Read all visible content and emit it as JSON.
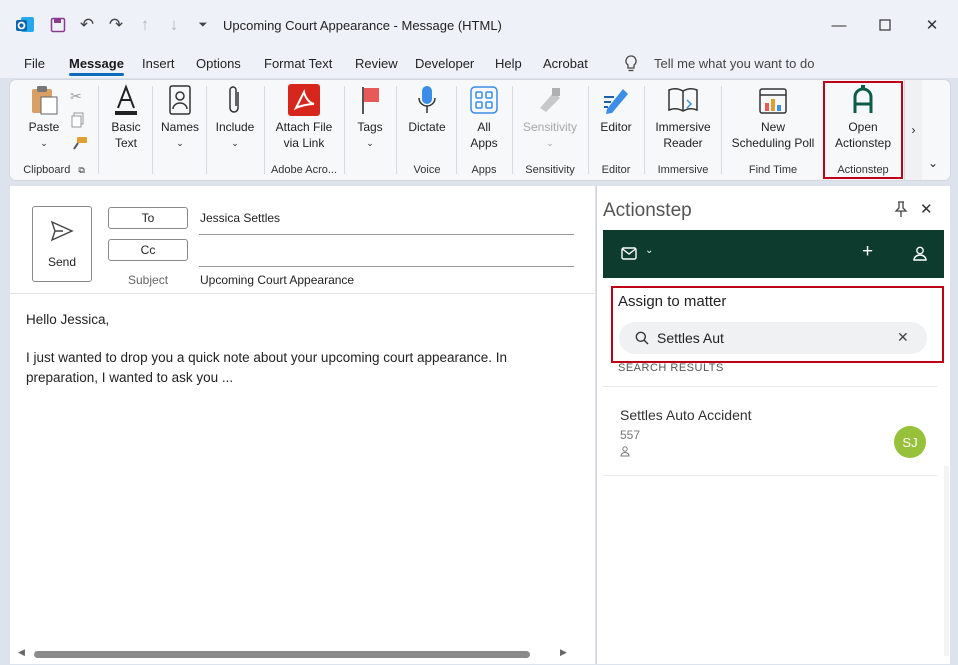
{
  "window": {
    "title": "Upcoming Court Appearance  -  Message (HTML)"
  },
  "menu": {
    "tabs": [
      "File",
      "Message",
      "Insert",
      "Options",
      "Format Text",
      "Review",
      "Developer",
      "Help",
      "Acrobat"
    ],
    "active": "Message",
    "tell_me": "Tell me what you want to do"
  },
  "ribbon": {
    "clipboard": {
      "paste": "Paste",
      "group": "Clipboard"
    },
    "basic_text": "Basic\nText",
    "names": "Names",
    "include": "Include",
    "adobe": {
      "attach": "Attach File\nvia Link",
      "group": "Adobe Acro..."
    },
    "tags": "Tags",
    "voice": {
      "dictate": "Dictate",
      "group": "Voice"
    },
    "apps": {
      "all_apps": "All\nApps",
      "group": "Apps"
    },
    "sensitivity": {
      "label": "Sensitivity",
      "group": "Sensitivity"
    },
    "editor": {
      "label": "Editor",
      "group": "Editor"
    },
    "immersive": {
      "label": "Immersive\nReader",
      "group": "Immersive"
    },
    "find_time": {
      "label": "New\nScheduling Poll",
      "group": "Find Time"
    },
    "actionstep": {
      "label": "Open\nActionstep",
      "group": "Actionstep"
    }
  },
  "compose": {
    "send": "Send",
    "to_label": "To",
    "to_value": "Jessica Settles",
    "cc_label": "Cc",
    "cc_value": "",
    "subject_label": "Subject",
    "subject_value": "Upcoming Court Appearance",
    "body_greeting": "Hello Jessica,",
    "body_text": "I just wanted to drop you a quick note about your upcoming court appearance. In preparation, I wanted to ask you ..."
  },
  "pane": {
    "title": "Actionstep",
    "assign_heading": "Assign to matter",
    "search_value": "Settles Aut",
    "results_heading": "SEARCH RESULTS",
    "results": [
      {
        "name": "Settles Auto Accident",
        "number": "557",
        "initials": "SJ"
      }
    ]
  },
  "colors": {
    "accent": "#0f6cbd",
    "pane_bar": "#0d3b2e",
    "highlight": "#c00018",
    "avatar": "#98c13b"
  }
}
